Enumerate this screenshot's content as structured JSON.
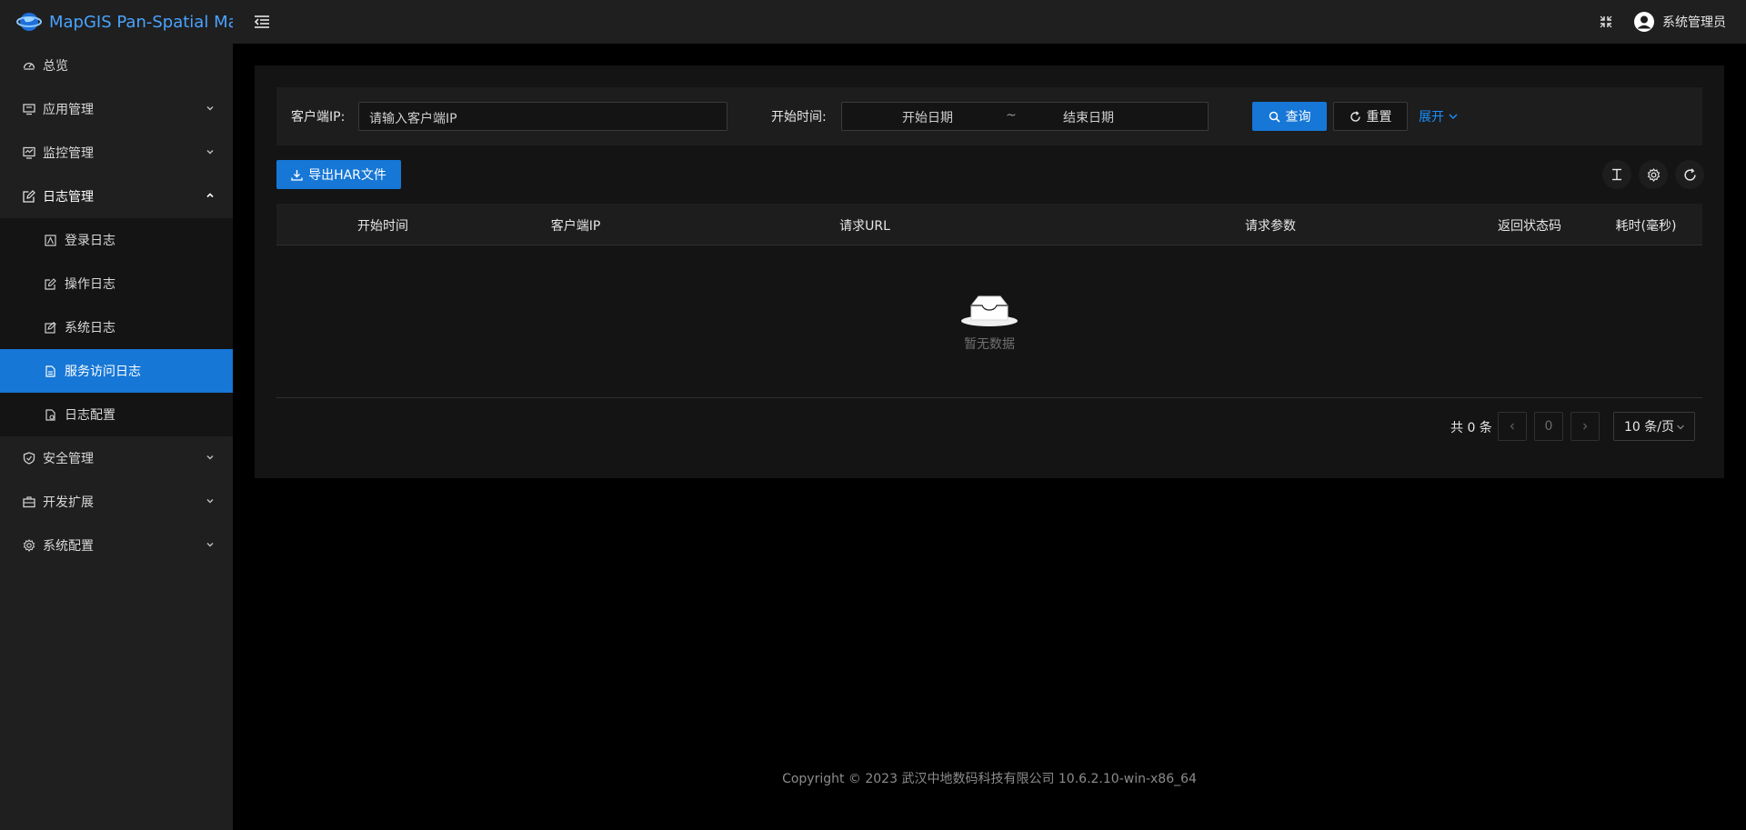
{
  "app": {
    "title": "MapGIS Pan-Spatial Map"
  },
  "header": {
    "username": "系统管理员"
  },
  "sidebar": {
    "items": [
      {
        "label": "总览",
        "icon": "dashboard-icon"
      },
      {
        "label": "应用管理",
        "icon": "app-icon"
      },
      {
        "label": "监控管理",
        "icon": "monitor-icon"
      },
      {
        "label": "日志管理",
        "icon": "edit-icon"
      },
      {
        "label": "安全管理",
        "icon": "shield-icon"
      },
      {
        "label": "开发扩展",
        "icon": "toolbox-icon"
      },
      {
        "label": "系统配置",
        "icon": "gear-icon"
      }
    ],
    "log_sub": [
      {
        "label": "登录日志"
      },
      {
        "label": "操作日志"
      },
      {
        "label": "系统日志"
      },
      {
        "label": "服务访问日志",
        "active": true
      },
      {
        "label": "日志配置"
      }
    ]
  },
  "search": {
    "client_ip_label": "客户端IP:",
    "client_ip_placeholder": "请输入客户端IP",
    "start_time_label": "开始时间:",
    "start_date_placeholder": "开始日期",
    "range_separator": "~",
    "end_date_placeholder": "结束日期",
    "query_label": "查询",
    "reset_label": "重置",
    "expand_label": "展开"
  },
  "toolbar": {
    "export_label": "导出HAR文件"
  },
  "table": {
    "columns": [
      "开始时间",
      "客户端IP",
      "请求URL",
      "请求参数",
      "返回状态码",
      "耗时(毫秒)"
    ],
    "rows": [],
    "empty_text": "暂无数据"
  },
  "pagination": {
    "total_text": "共 0 条",
    "current_page": "0",
    "page_size": "10 条/页"
  },
  "footer": {
    "copyright": "Copyright © 2023 武汉中地数码科技有限公司 10.6.2.10-win-x86_64"
  },
  "colors": {
    "primary": "#1677d6",
    "sidebar_bg": "#1f1f1f",
    "page_bg": "#000000",
    "panel_bg": "#141414"
  }
}
